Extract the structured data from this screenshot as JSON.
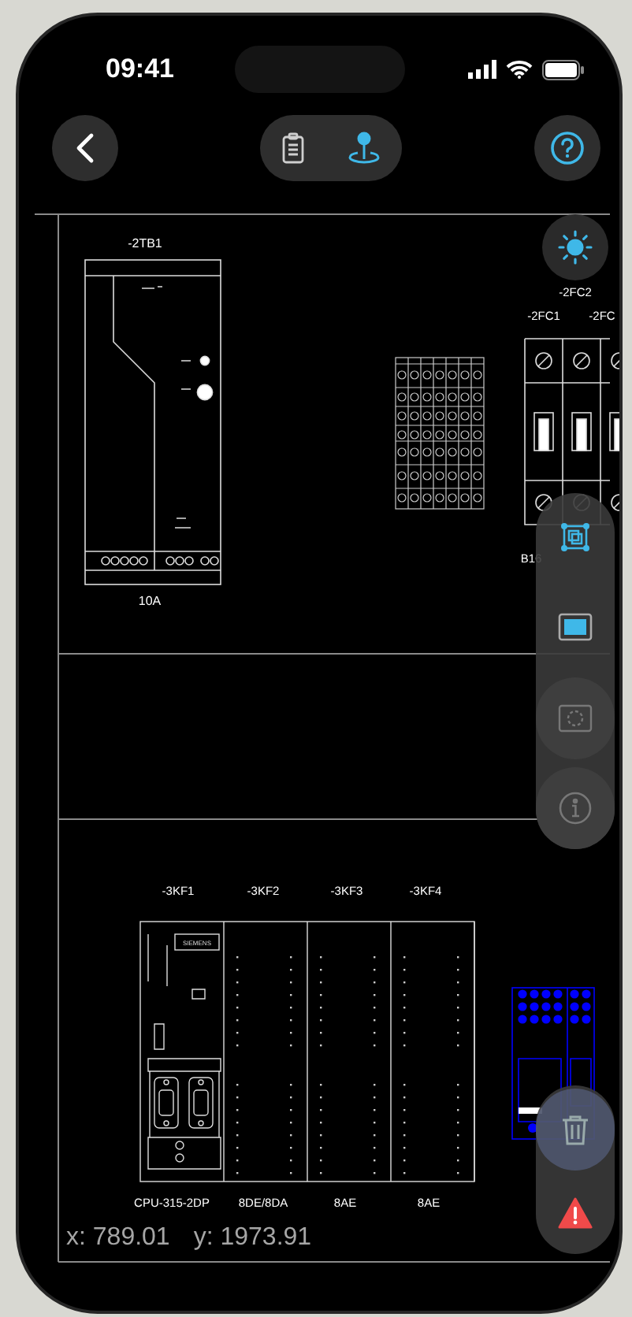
{
  "status_bar": {
    "time": "09:41"
  },
  "toolbar": {
    "modes": [
      {
        "kind": "list",
        "selected": false
      },
      {
        "kind": "pin",
        "selected": true
      }
    ]
  },
  "drawing": {
    "power_supply": {
      "tag": "-2TB1",
      "rating": "10A"
    },
    "breakers": {
      "tags": [
        "-2FC1",
        "-2FC2",
        "-2FC"
      ],
      "rating": "B16"
    },
    "plc": {
      "brand": "SIEMENS",
      "modules": [
        {
          "tag": "-3KF1",
          "caption": "CPU-315-2DP"
        },
        {
          "tag": "-3KF2",
          "caption": "8DE/8DA"
        },
        {
          "tag": "-3KF3",
          "caption": "8AE"
        },
        {
          "tag": "-3KF4",
          "caption": "8AE"
        }
      ]
    }
  },
  "side_tools": [
    {
      "kind": "select",
      "active": true
    },
    {
      "kind": "rectangle",
      "active": true
    },
    {
      "kind": "circle",
      "active": false
    },
    {
      "kind": "info",
      "active": false
    }
  ],
  "action_tools": [
    {
      "kind": "delete"
    },
    {
      "kind": "warning"
    }
  ],
  "cursor": {
    "x": "x: 789.01",
    "y": "y: 1973.91"
  }
}
